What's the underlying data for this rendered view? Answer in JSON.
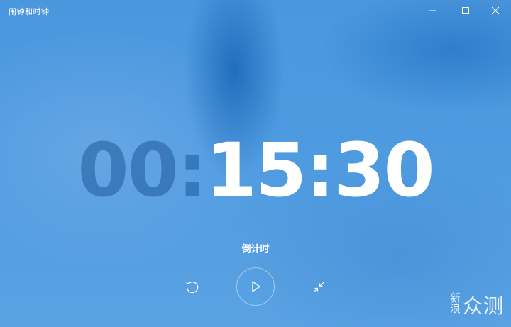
{
  "window": {
    "title": "闹钟和时钟"
  },
  "titlebar_icons": {
    "minimize": "minimize-icon",
    "maximize": "maximize-icon",
    "close": "close-icon"
  },
  "timer": {
    "hours": "00",
    "minutes": "15",
    "seconds": "30",
    "separator": ":",
    "mode_label": "倒计时"
  },
  "controls": {
    "reset": "reset-icon",
    "play": "play-icon",
    "compact": "collapse-arrows-icon"
  },
  "watermark": {
    "small": "新浪",
    "big": "众测"
  },
  "colors": {
    "background": "#4f9be0",
    "dim_digits": "#1e5a9b",
    "bright_digits": "#ffffff"
  }
}
